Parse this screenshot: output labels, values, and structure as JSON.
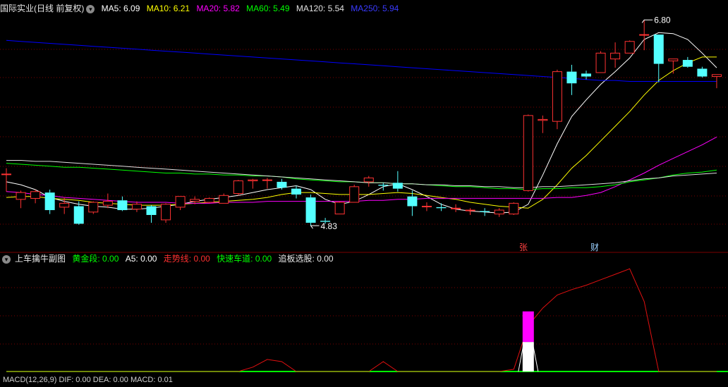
{
  "colors": {
    "bg": "#000000",
    "grid": "#7a0000",
    "up": "#ff3232",
    "down": "#54ffff",
    "ma5": "#ffffff",
    "ma10": "#ffff00",
    "ma20": "#ff00ff",
    "ma60": "#00ff00",
    "ma120": "#e0e0e0",
    "ma250": "#0000ff"
  },
  "main_header": {
    "title": "国际实业(日线 前复权)",
    "toggle_icon": "chevron-down-icon",
    "ma5": "MA5: 6.09",
    "ma10": "MA10: 6.21",
    "ma20": "MA20: 5.82",
    "ma60": "MA60: 5.49",
    "ma120": "MA120: 5.54",
    "ma250": "MA250: 5.94"
  },
  "sub_header": {
    "title": "上车擒牛副图",
    "toggle_icon": "chevron-down-icon",
    "gold": "黄金段: 0.00",
    "a5": "A5: 0.00",
    "trend": "走势线: 0.00",
    "fast": "快速车道: 0.00",
    "pick": "追板选股: 0.00"
  },
  "bottom_header": "MACD(12,26,9) DIF: 0.00 DEA: 0.00 MACD: 0.01",
  "annotations": {
    "high": "6.80",
    "low": "4.83",
    "mark_zhang": "张",
    "mark_cai": "财"
  },
  "chart_data": [
    {
      "type": "candlestick",
      "title": "国际实业(日线 前复权)",
      "ylim": [
        4.6,
        7.0
      ],
      "candles": [
        [
          5.36,
          5.36,
          5.19,
          5.18,
          5.42
        ],
        [
          5.1,
          5.17,
          5.1,
          5.01,
          5.19
        ],
        [
          5.11,
          5.18,
          5.1,
          5.06,
          5.2
        ],
        [
          5.17,
          4.99,
          5.17,
          4.95,
          5.2
        ],
        [
          5.02,
          5.06,
          5.0,
          4.95,
          5.12
        ],
        [
          5.03,
          4.85,
          5.03,
          4.84,
          5.08
        ],
        [
          4.97,
          5.07,
          4.97,
          4.95,
          5.08
        ],
        [
          5.04,
          5.08,
          5.03,
          5.01,
          5.16
        ],
        [
          5.09,
          4.99,
          5.11,
          4.98,
          5.13
        ],
        [
          5.0,
          5.05,
          5.0,
          4.97,
          5.08
        ],
        [
          5.03,
          4.94,
          5.03,
          4.86,
          5.04
        ],
        [
          4.89,
          5.05,
          4.89,
          4.86,
          5.06
        ],
        [
          5.02,
          5.13,
          5.02,
          4.99,
          5.13
        ],
        [
          5.08,
          5.1,
          5.1,
          5.05,
          5.13
        ],
        [
          5.07,
          5.11,
          5.07,
          5.06,
          5.12
        ],
        [
          5.06,
          5.14,
          5.06,
          5.06,
          5.16
        ],
        [
          5.16,
          5.29,
          5.16,
          5.14,
          5.3
        ],
        [
          5.29,
          5.3,
          5.29,
          5.21,
          5.31
        ],
        [
          5.3,
          5.3,
          5.3,
          5.21,
          5.32
        ],
        [
          5.28,
          5.22,
          5.3,
          5.2,
          5.31
        ],
        [
          5.21,
          5.15,
          5.22,
          5.11,
          5.24
        ],
        [
          5.12,
          4.86,
          5.12,
          4.83,
          5.15
        ],
        [
          4.88,
          4.87,
          4.88,
          4.85,
          4.91
        ],
        [
          4.95,
          5.07,
          4.95,
          4.95,
          5.08
        ],
        [
          5.07,
          5.23,
          5.07,
          5.07,
          5.25
        ],
        [
          5.28,
          5.32,
          5.28,
          5.23,
          5.34
        ],
        [
          5.25,
          5.24,
          5.25,
          5.19,
          5.27
        ],
        [
          5.27,
          5.21,
          5.27,
          5.18,
          5.39
        ],
        [
          5.13,
          5.03,
          5.14,
          4.93,
          5.19
        ],
        [
          5.03,
          5.03,
          5.03,
          4.98,
          5.07
        ],
        [
          5.02,
          5.01,
          5.02,
          4.98,
          5.06
        ],
        [
          5.01,
          5.01,
          5.01,
          4.97,
          5.05
        ],
        [
          4.99,
          4.99,
          4.99,
          4.94,
          5.01
        ],
        [
          4.98,
          4.97,
          4.98,
          4.93,
          5.01
        ],
        [
          4.95,
          4.99,
          4.95,
          4.92,
          5.01
        ],
        [
          4.95,
          5.06,
          4.95,
          4.94,
          5.07
        ],
        [
          5.19,
          5.96,
          5.19,
          5.18,
          5.97
        ],
        [
          5.91,
          5.92,
          5.91,
          5.78,
          5.96
        ],
        [
          5.9,
          6.41,
          5.88,
          5.82,
          6.43
        ],
        [
          6.41,
          6.29,
          6.41,
          6.17,
          6.48
        ],
        [
          6.39,
          6.36,
          6.39,
          6.33,
          6.42
        ],
        [
          6.4,
          6.6,
          6.41,
          6.4,
          6.62
        ],
        [
          6.54,
          6.6,
          6.54,
          6.45,
          6.71
        ],
        [
          6.6,
          6.72,
          6.6,
          6.6,
          6.73
        ],
        [
          6.79,
          6.79,
          6.79,
          6.63,
          6.94
        ],
        [
          6.79,
          6.49,
          6.79,
          6.3,
          6.79
        ],
        [
          6.52,
          6.54,
          6.52,
          6.39,
          6.54
        ],
        [
          6.53,
          6.46,
          6.53,
          6.45,
          6.56
        ],
        [
          6.44,
          6.36,
          6.44,
          6.35,
          6.46
        ],
        [
          6.36,
          6.38,
          6.36,
          6.24,
          6.38
        ]
      ],
      "ma_lines": [
        {
          "name": "MA5",
          "values": [
            5.28,
            5.25,
            5.2,
            5.12,
            5.08,
            5.05,
            5.03,
            5.02,
            5.0,
            5.0,
            5.01,
            5.03,
            5.05,
            5.08,
            5.1,
            5.12,
            5.14,
            5.17,
            5.2,
            5.22,
            5.24,
            5.2,
            5.1,
            5.05,
            5.08,
            5.15,
            5.23,
            5.26,
            5.2,
            5.13,
            5.05,
            5.0,
            4.98,
            4.97,
            4.96,
            4.97,
            5.05,
            5.35,
            5.67,
            5.95,
            6.12,
            6.28,
            6.41,
            6.55,
            6.74,
            6.81,
            6.8,
            6.74,
            6.6,
            6.45
          ]
        },
        {
          "name": "MA10",
          "values": [
            5.12,
            5.13,
            5.13,
            5.11,
            5.1,
            5.09,
            5.07,
            5.06,
            5.05,
            5.04,
            5.04,
            5.04,
            5.05,
            5.06,
            5.07,
            5.08,
            5.09,
            5.1,
            5.12,
            5.15,
            5.17,
            5.17,
            5.16,
            5.15,
            5.15,
            5.15,
            5.16,
            5.17,
            5.16,
            5.14,
            5.12,
            5.1,
            5.07,
            5.05,
            5.03,
            5.02,
            5.01,
            5.1,
            5.25,
            5.42,
            5.55,
            5.7,
            5.85,
            6.0,
            6.17,
            6.32,
            6.42,
            6.5,
            6.56,
            6.56
          ]
        },
        {
          "name": "MA20",
          "values": [
            5.18,
            5.17,
            5.15,
            5.14,
            5.12,
            5.11,
            5.1,
            5.09,
            5.08,
            5.07,
            5.07,
            5.07,
            5.06,
            5.06,
            5.06,
            5.07,
            5.07,
            5.07,
            5.08,
            5.08,
            5.08,
            5.08,
            5.08,
            5.08,
            5.08,
            5.09,
            5.09,
            5.1,
            5.1,
            5.11,
            5.11,
            5.11,
            5.11,
            5.11,
            5.11,
            5.11,
            5.11,
            5.11,
            5.12,
            5.12,
            5.14,
            5.17,
            5.23,
            5.3,
            5.37,
            5.45,
            5.52,
            5.59,
            5.66,
            5.74
          ]
        },
        {
          "name": "MA60",
          "values": [
            5.47,
            5.46,
            5.45,
            5.44,
            5.43,
            5.43,
            5.42,
            5.41,
            5.4,
            5.39,
            5.38,
            5.37,
            5.37,
            5.36,
            5.36,
            5.35,
            5.35,
            5.34,
            5.34,
            5.33,
            5.31,
            5.3,
            5.29,
            5.28,
            5.28,
            5.27,
            5.27,
            5.26,
            5.26,
            5.25,
            5.24,
            5.23,
            5.23,
            5.22,
            5.21,
            5.21,
            5.2,
            5.21,
            5.21,
            5.22,
            5.22,
            5.23,
            5.25,
            5.28,
            5.3,
            5.32,
            5.35,
            5.37,
            5.38,
            5.4
          ]
        },
        {
          "name": "MA120",
          "values": [
            5.5,
            5.5,
            5.49,
            5.49,
            5.48,
            5.47,
            5.46,
            5.45,
            5.44,
            5.43,
            5.42,
            5.41,
            5.4,
            5.39,
            5.38,
            5.37,
            5.36,
            5.35,
            5.34,
            5.33,
            5.32,
            5.31,
            5.3,
            5.29,
            5.28,
            5.27,
            5.27,
            5.26,
            5.26,
            5.25,
            5.25,
            5.24,
            5.24,
            5.23,
            5.23,
            5.22,
            5.22,
            5.23,
            5.23,
            5.24,
            5.25,
            5.26,
            5.27,
            5.29,
            5.31,
            5.32,
            5.34,
            5.35,
            5.36,
            5.37
          ]
        },
        {
          "name": "MA250",
          "values": [
            6.73,
            6.72,
            6.71,
            6.7,
            6.69,
            6.68,
            6.67,
            6.66,
            6.65,
            6.64,
            6.63,
            6.62,
            6.61,
            6.6,
            6.59,
            6.58,
            6.57,
            6.56,
            6.55,
            6.54,
            6.53,
            6.52,
            6.51,
            6.5,
            6.49,
            6.48,
            6.47,
            6.46,
            6.45,
            6.44,
            6.43,
            6.42,
            6.41,
            6.4,
            6.39,
            6.38,
            6.37,
            6.36,
            6.35,
            6.34,
            6.33,
            6.32,
            6.32,
            6.31,
            6.31,
            6.31,
            6.31,
            6.31,
            6.31,
            6.31
          ]
        }
      ]
    },
    {
      "type": "line",
      "title": "上车擒牛副图",
      "ylim": [
        0,
        10
      ],
      "series": [
        {
          "name": "走势线",
          "values": [
            0,
            0,
            0,
            0,
            0,
            0,
            0,
            0,
            0,
            0,
            0,
            0,
            0,
            0,
            0,
            0,
            0,
            0.4,
            1.1,
            0.9,
            0,
            0,
            0,
            0,
            0,
            0,
            0.9,
            0,
            0,
            0,
            0,
            0,
            0,
            0,
            0,
            0.2,
            4.2,
            5.8,
            7.0,
            7.5,
            7.9,
            8.4,
            8.9,
            9.4,
            6.4,
            0,
            0,
            0,
            0,
            0
          ]
        },
        {
          "name": "快速车道",
          "values": [
            0,
            0,
            0,
            0,
            0,
            0,
            0,
            0,
            0,
            0,
            0,
            0,
            0,
            0,
            0,
            0,
            0,
            0,
            0,
            0,
            0,
            0,
            0,
            0,
            0,
            0,
            0,
            0,
            0,
            0,
            0,
            0,
            0,
            0,
            0,
            0,
            0,
            0,
            0,
            0,
            0,
            0,
            0,
            0,
            0,
            0,
            0,
            0,
            0,
            0
          ]
        }
      ],
      "bars": [
        {
          "index": 36,
          "lower": 2.7,
          "upper": 5.5
        }
      ]
    }
  ]
}
